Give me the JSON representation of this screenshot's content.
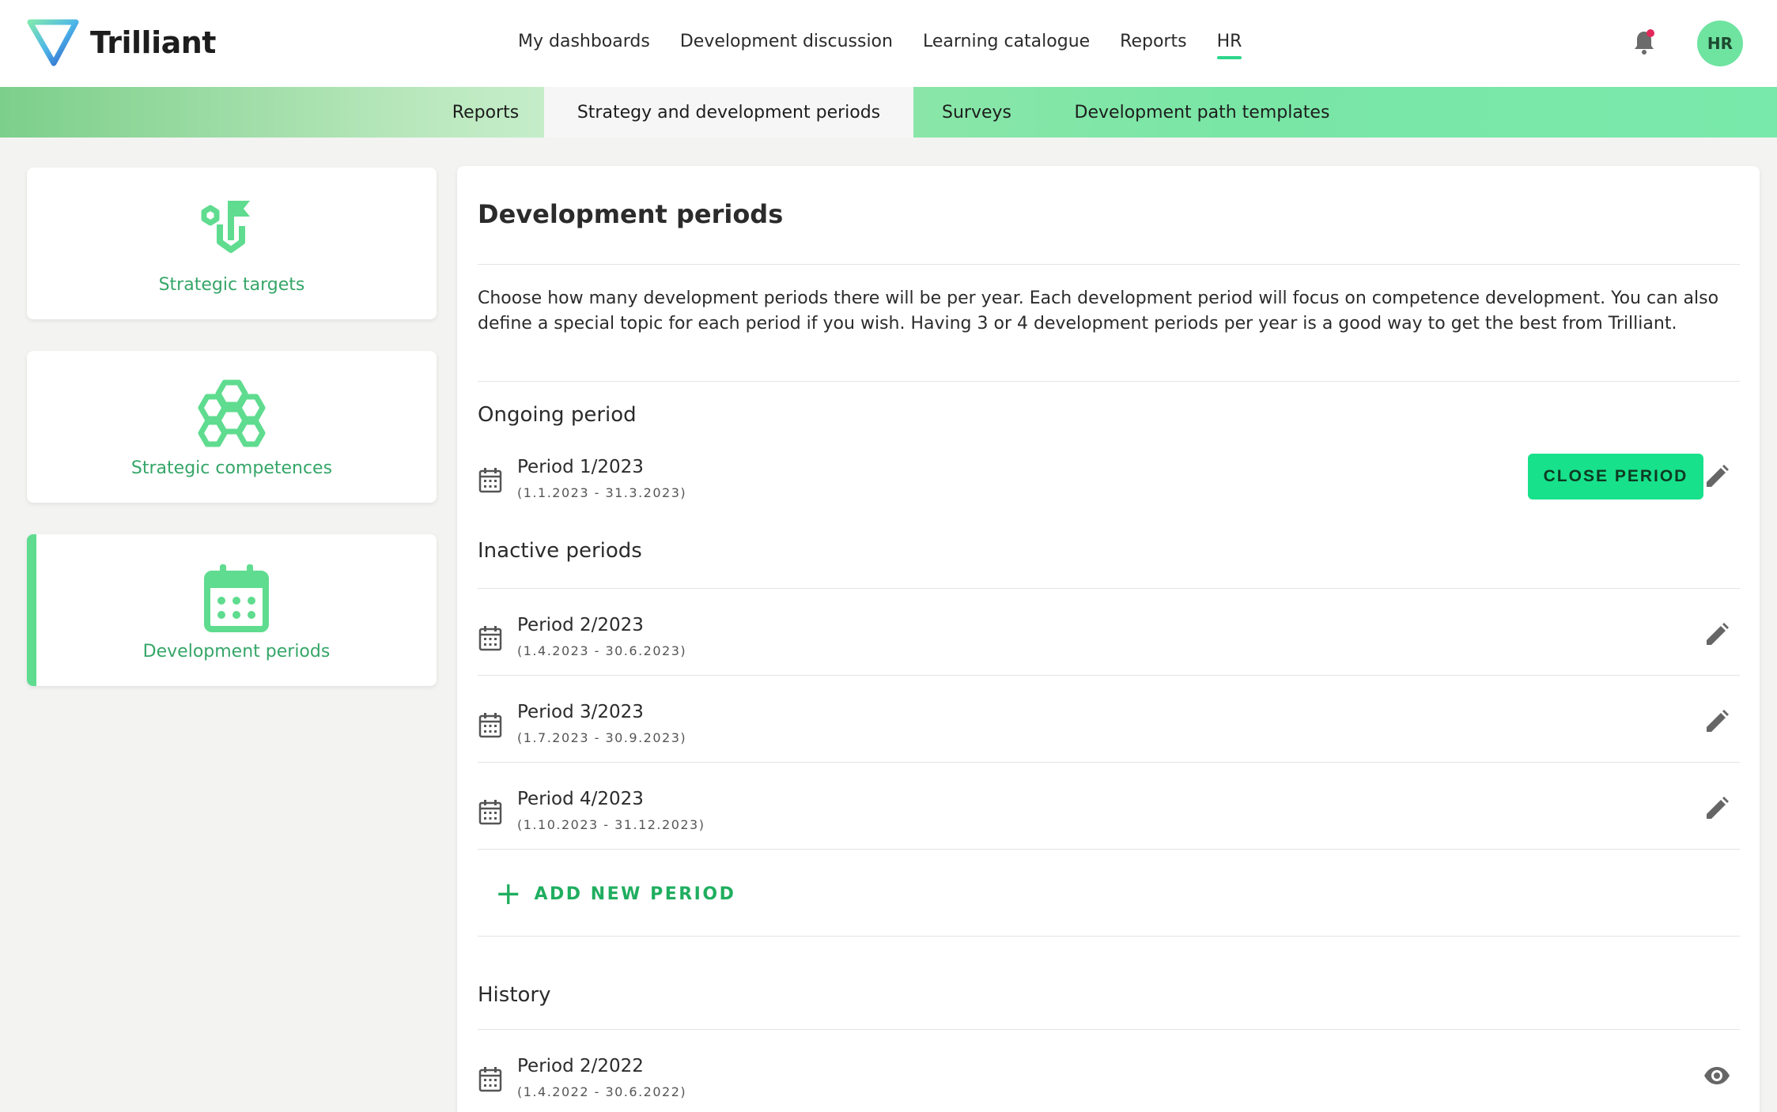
{
  "app": {
    "name": "Trilliant"
  },
  "main_nav": [
    "My dashboards",
    "Development discussion",
    "Learning catalogue",
    "Reports",
    "HR"
  ],
  "user": {
    "initials": "HR"
  },
  "sub_nav": [
    "Reports",
    "Strategy and development periods",
    "Surveys",
    "Development path templates"
  ],
  "sidebar": [
    {
      "label": "Strategic targets",
      "icon": "target-flag-icon"
    },
    {
      "label": "Strategic competences",
      "icon": "hexagon-cluster-icon"
    },
    {
      "label": "Development periods",
      "icon": "calendar-icon"
    }
  ],
  "content": {
    "title": "Development periods",
    "description": "Choose how many development periods there will be per year. Each development period will focus on competence development. You can also define a special topic for each period if you wish. Having 3 or 4 development periods per year is a good way to get the best from Trilliant.",
    "ongoing": {
      "heading": "Ongoing period",
      "period": {
        "name": "Period 1/2023",
        "dates": "(1.1.2023 - 31.3.2023)"
      },
      "close_label": "CLOSE PERIOD"
    },
    "inactive": {
      "heading": "Inactive periods",
      "periods": [
        {
          "name": "Period 2/2023",
          "dates": "(1.4.2023 - 30.6.2023)"
        },
        {
          "name": "Period 3/2023",
          "dates": "(1.7.2023 - 30.9.2023)"
        },
        {
          "name": "Period 4/2023",
          "dates": "(1.10.2023 - 31.12.2023)"
        }
      ]
    },
    "add_label": "ADD NEW PERIOD",
    "history": {
      "heading": "History",
      "periods": [
        {
          "name": "Period 2/2022",
          "dates": "(1.4.2022 - 30.6.2022)"
        }
      ]
    }
  },
  "colors": {
    "accent": "#18e18b",
    "brand_green": "#35a668",
    "active_underline": "#2ed68a"
  }
}
